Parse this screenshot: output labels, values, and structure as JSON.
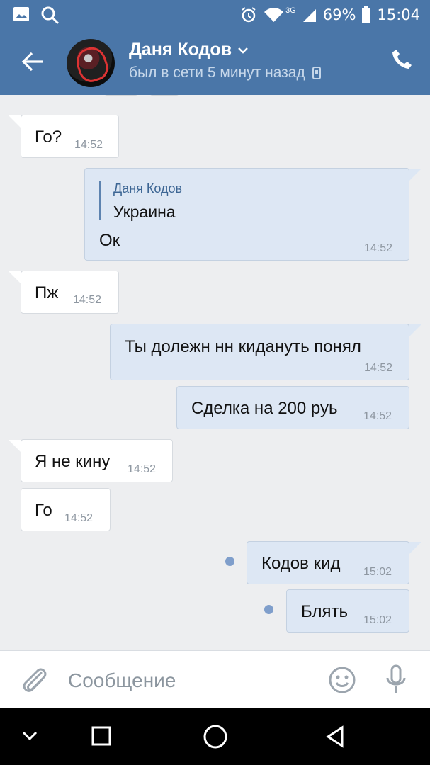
{
  "status_bar": {
    "network": "3G",
    "battery": "69%",
    "time": "15:04",
    "icons": [
      "image-icon",
      "search-icon",
      "alarm-icon",
      "wifi-icon",
      "signal-icon",
      "battery-icon"
    ]
  },
  "header": {
    "contact_name": "Даня Кодов",
    "last_seen": "был в сети 5 минут назад",
    "icons": [
      "back-arrow-icon",
      "chevron-down-icon",
      "mobile-device-icon",
      "phone-icon"
    ]
  },
  "messages": [
    {
      "direction": "incoming",
      "text": "Го?",
      "time": "14:52"
    },
    {
      "direction": "outgoing",
      "reply_author": "Даня Кодов",
      "reply_text": "Украина",
      "text": "Ок",
      "time": "14:52"
    },
    {
      "direction": "incoming",
      "text": "Пж",
      "time": "14:52"
    },
    {
      "direction": "outgoing",
      "text": "Ты долежн нн кидануть понял",
      "time": "14:52"
    },
    {
      "direction": "outgoing",
      "text": "Сделка на 200 руь",
      "time": "14:52"
    },
    {
      "direction": "incoming",
      "text": "Я не кину",
      "time": "14:52"
    },
    {
      "direction": "incoming",
      "text": "Го",
      "time": "14:52"
    },
    {
      "direction": "outgoing",
      "text": "Кодов кид",
      "time": "15:02",
      "unread": true
    },
    {
      "direction": "outgoing",
      "text": "Блять",
      "time": "15:02",
      "unread": true
    }
  ],
  "composer": {
    "placeholder": "Сообщение",
    "icons": [
      "attachment-icon",
      "emoji-icon",
      "microphone-icon"
    ]
  },
  "nav_bar": {
    "icons": [
      "nav-down-icon",
      "recent-apps-icon",
      "home-icon",
      "back-icon"
    ]
  },
  "colors": {
    "header": "#4a76a8",
    "chat_background": "#edeef0",
    "incoming_bubble": "#ffffff",
    "outgoing_bubble": "#dde7f4",
    "accent": "#7f9ecb"
  }
}
